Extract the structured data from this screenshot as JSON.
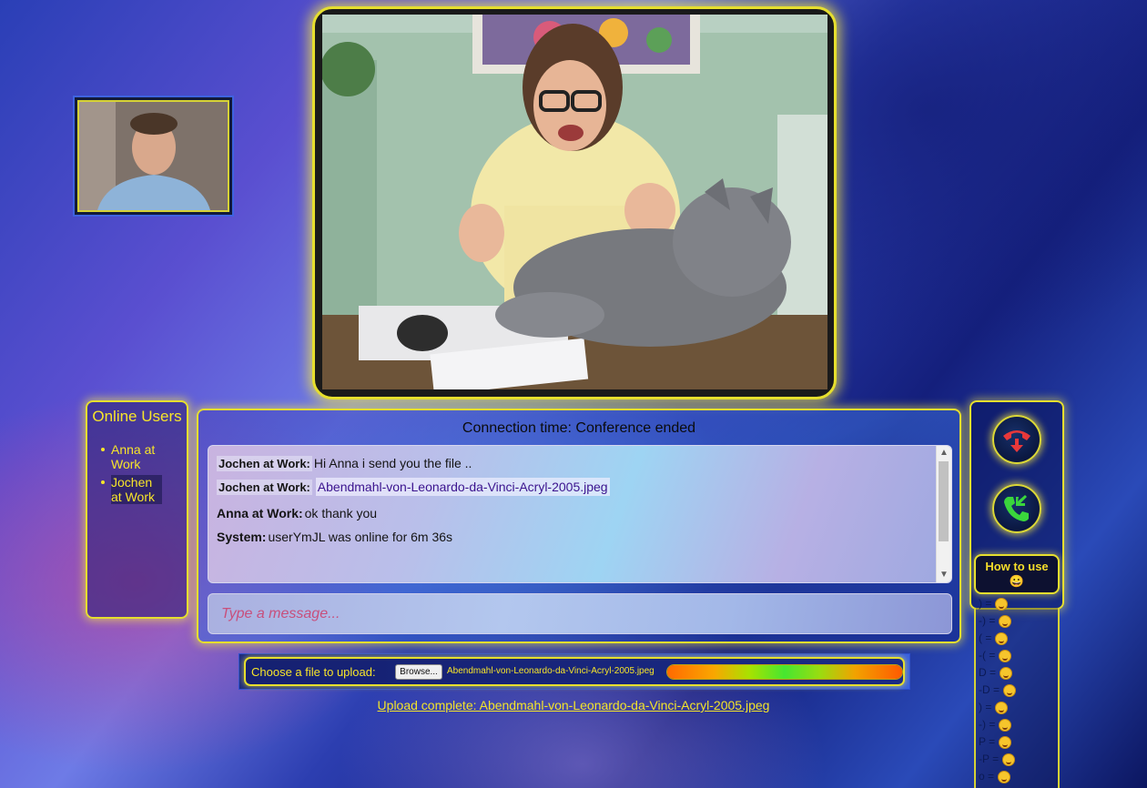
{
  "videos": {
    "remote_alt": "Remote participant video",
    "local_alt": "Local participant video"
  },
  "online_users": {
    "title": "Online Users",
    "users": [
      "Anna at Work",
      "Jochen at Work"
    ]
  },
  "chat": {
    "connection_label": "Connection time:",
    "connection_value": "Conference ended",
    "messages": [
      {
        "sender": "Jochen at Work:",
        "text": "Hi Anna i send you the file .."
      },
      {
        "sender": "Jochen at Work:",
        "file_link": "Abendmahl-von-Leonardo-da-Vinci-Acryl-2005.jpeg"
      },
      {
        "sender": "Anna at Work:",
        "text": "ok thank you"
      },
      {
        "sender": "System:",
        "text": "userYmJL was online for 6m 36s"
      }
    ],
    "input_placeholder": "Type a message..."
  },
  "controls": {
    "hangup_icon": "phone-hangup-icon",
    "accept_icon": "phone-incoming-icon",
    "how_to_use_label": "How to use",
    "how_to_use_emoji": "😀",
    "accent_color": "#e6df2e",
    "hangup_color": "#e8383a",
    "accept_color": "#3ad63c"
  },
  "emoticons": [
    {
      "code": ") =",
      "emoji": "smile"
    },
    {
      "code": "-) =",
      "emoji": "smile"
    },
    {
      "code": "( =",
      "emoji": "sad"
    },
    {
      "code": "-( =",
      "emoji": "sad"
    },
    {
      "code": "D =",
      "emoji": "grin"
    },
    {
      "code": "-D =",
      "emoji": "grin"
    },
    {
      "code": ") =",
      "emoji": "wink"
    },
    {
      "code": "-) =",
      "emoji": "wink"
    },
    {
      "code": "P =",
      "emoji": "tongue"
    },
    {
      "code": "-P =",
      "emoji": "tongue"
    },
    {
      "code": "o =",
      "emoji": "surprised"
    }
  ],
  "upload": {
    "label": "Choose a file to upload:",
    "browse_label": "Browse...",
    "file_name": "Abendmahl-von-Leonardo-da-Vinci-Acryl-2005.jpeg",
    "progress": 1.0,
    "status_link": "Upload complete: Abendmahl-von-Leonardo-da-Vinci-Acryl-2005.jpeg"
  }
}
